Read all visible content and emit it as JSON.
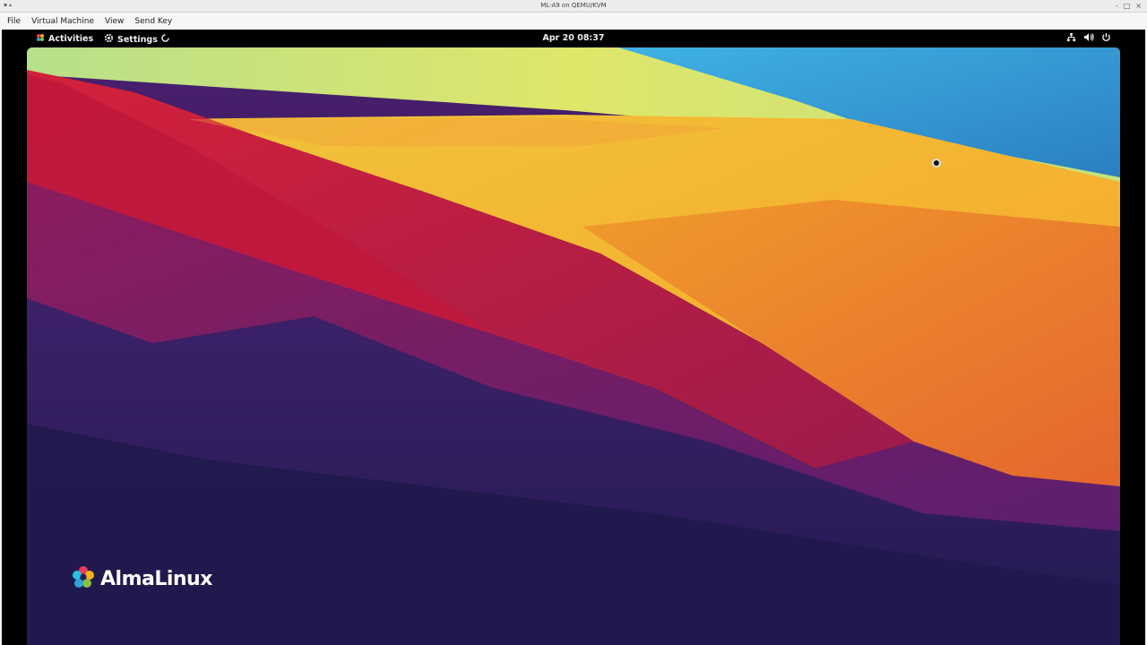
{
  "window": {
    "title": "ML-A9 on QEMU/KVM",
    "controls": [
      "-",
      "□",
      "×"
    ]
  },
  "menubar": {
    "items": [
      "File",
      "Virtual Machine",
      "View",
      "Send Key"
    ]
  },
  "gnome_topbar": {
    "activities_label": "Activities",
    "app_menu_label": "Settings",
    "clock": "Apr 20  08:37",
    "status_icons": [
      "network-icon",
      "volume-icon",
      "power-icon"
    ]
  },
  "desktop": {
    "brand": "AlmaLinux",
    "colors": {
      "purple_dark": "#2a1c57",
      "purple": "#6a1e6e",
      "red": "#c81a3a",
      "orange": "#e8832a",
      "yellow": "#f5c232",
      "lime": "#cfe37e",
      "blue": "#2a9bd6"
    }
  }
}
